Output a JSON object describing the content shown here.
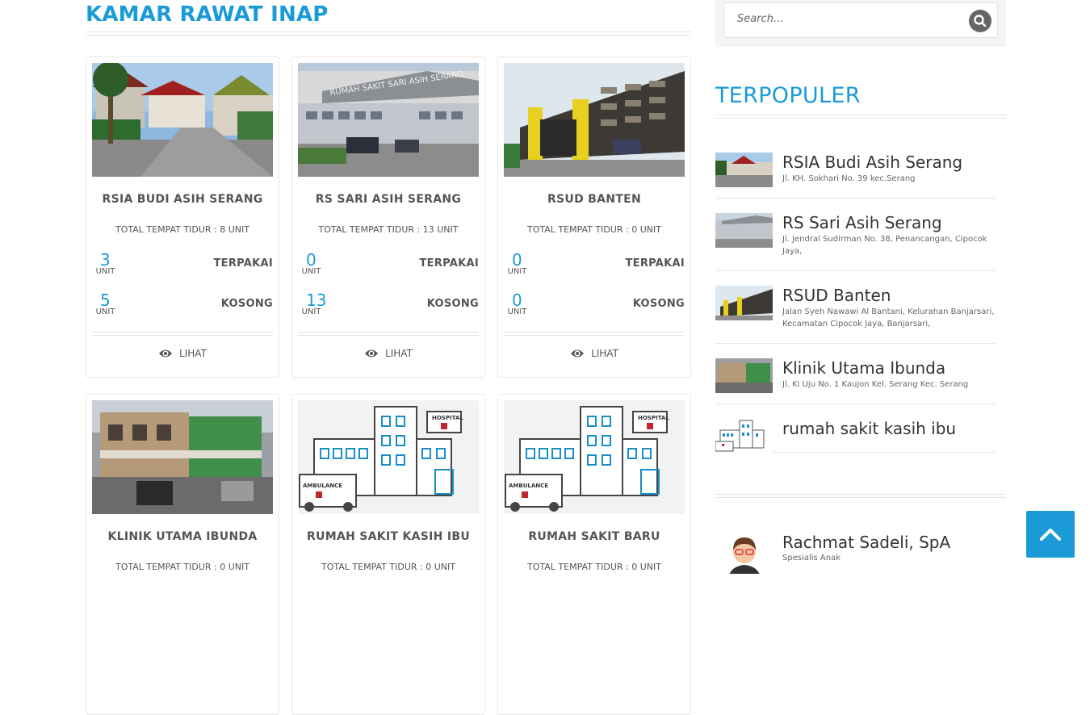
{
  "page": {
    "title": "KAMAR RAWAT INAP"
  },
  "colors": {
    "accent": "#1a9bd7",
    "text": "#555555",
    "muted": "#666666"
  },
  "cards": [
    {
      "name": "RSIA BUDI ASIH SERANG",
      "total": "TOTAL TEMPAT TIDUR : 8 UNIT",
      "used": "3",
      "empty": "5",
      "unit": "UNIT",
      "used_label": "TERPAKAI",
      "empty_label": "KOSONG",
      "view": "LIHAT",
      "image": "hospital-building-photo"
    },
    {
      "name": "RS SARI ASIH SERANG",
      "total": "TOTAL TEMPAT TIDUR : 13 UNIT",
      "used": "0",
      "empty": "13",
      "unit": "UNIT",
      "used_label": "TERPAKAI",
      "empty_label": "KOSONG",
      "view": "LIHAT",
      "image": "hospital-building-photo"
    },
    {
      "name": "RSUD BANTEN",
      "total": "TOTAL TEMPAT TIDUR : 0 UNIT",
      "used": "0",
      "empty": "0",
      "unit": "UNIT",
      "used_label": "TERPAKAI",
      "empty_label": "KOSONG",
      "view": "LIHAT",
      "image": "hospital-building-photo"
    },
    {
      "name": "KLINIK UTAMA IBUNDA",
      "total": "TOTAL TEMPAT TIDUR : 0 UNIT",
      "image": "street-view-photo"
    },
    {
      "name": "RUMAH SAKIT KASIH IBU",
      "total": "TOTAL TEMPAT TIDUR : 0 UNIT",
      "image": "hospital-ambulance-illustration"
    },
    {
      "name": "RUMAH SAKIT BARU",
      "total": "TOTAL TEMPAT TIDUR : 0 UNIT",
      "image": "hospital-ambulance-illustration"
    }
  ],
  "search": {
    "placeholder": "Search...",
    "icon": "search-icon"
  },
  "sidebar": {
    "title": "TERPOPULER",
    "items": [
      {
        "name": "RSIA Budi Asih Serang",
        "address": "Jl. KH. Sokhari No. 39 kec.Serang"
      },
      {
        "name": "RS Sari Asih Serang",
        "address": "Jl. Jendral Sudirman No. 38, Penancangan, Cipocok Jaya,"
      },
      {
        "name": "RSUD Banten",
        "address": "Jalan Syeh Nawawi Al Bantani, Kelurahan Banjarsari, Kecamatan Cipocok Jaya, Banjarsari,"
      },
      {
        "name": "Klinik Utama Ibunda",
        "address": "Jl. Ki Uju No. 1 Kaujon Kel. Serang Kec. Serang"
      },
      {
        "name": "rumah sakit kasih ibu",
        "address": ""
      }
    ],
    "doctor": {
      "name": "Rachmat Sadeli, SpA",
      "specialty": "Spesialis Anak"
    }
  },
  "back_to_top": {
    "icon": "chevron-up-icon"
  }
}
